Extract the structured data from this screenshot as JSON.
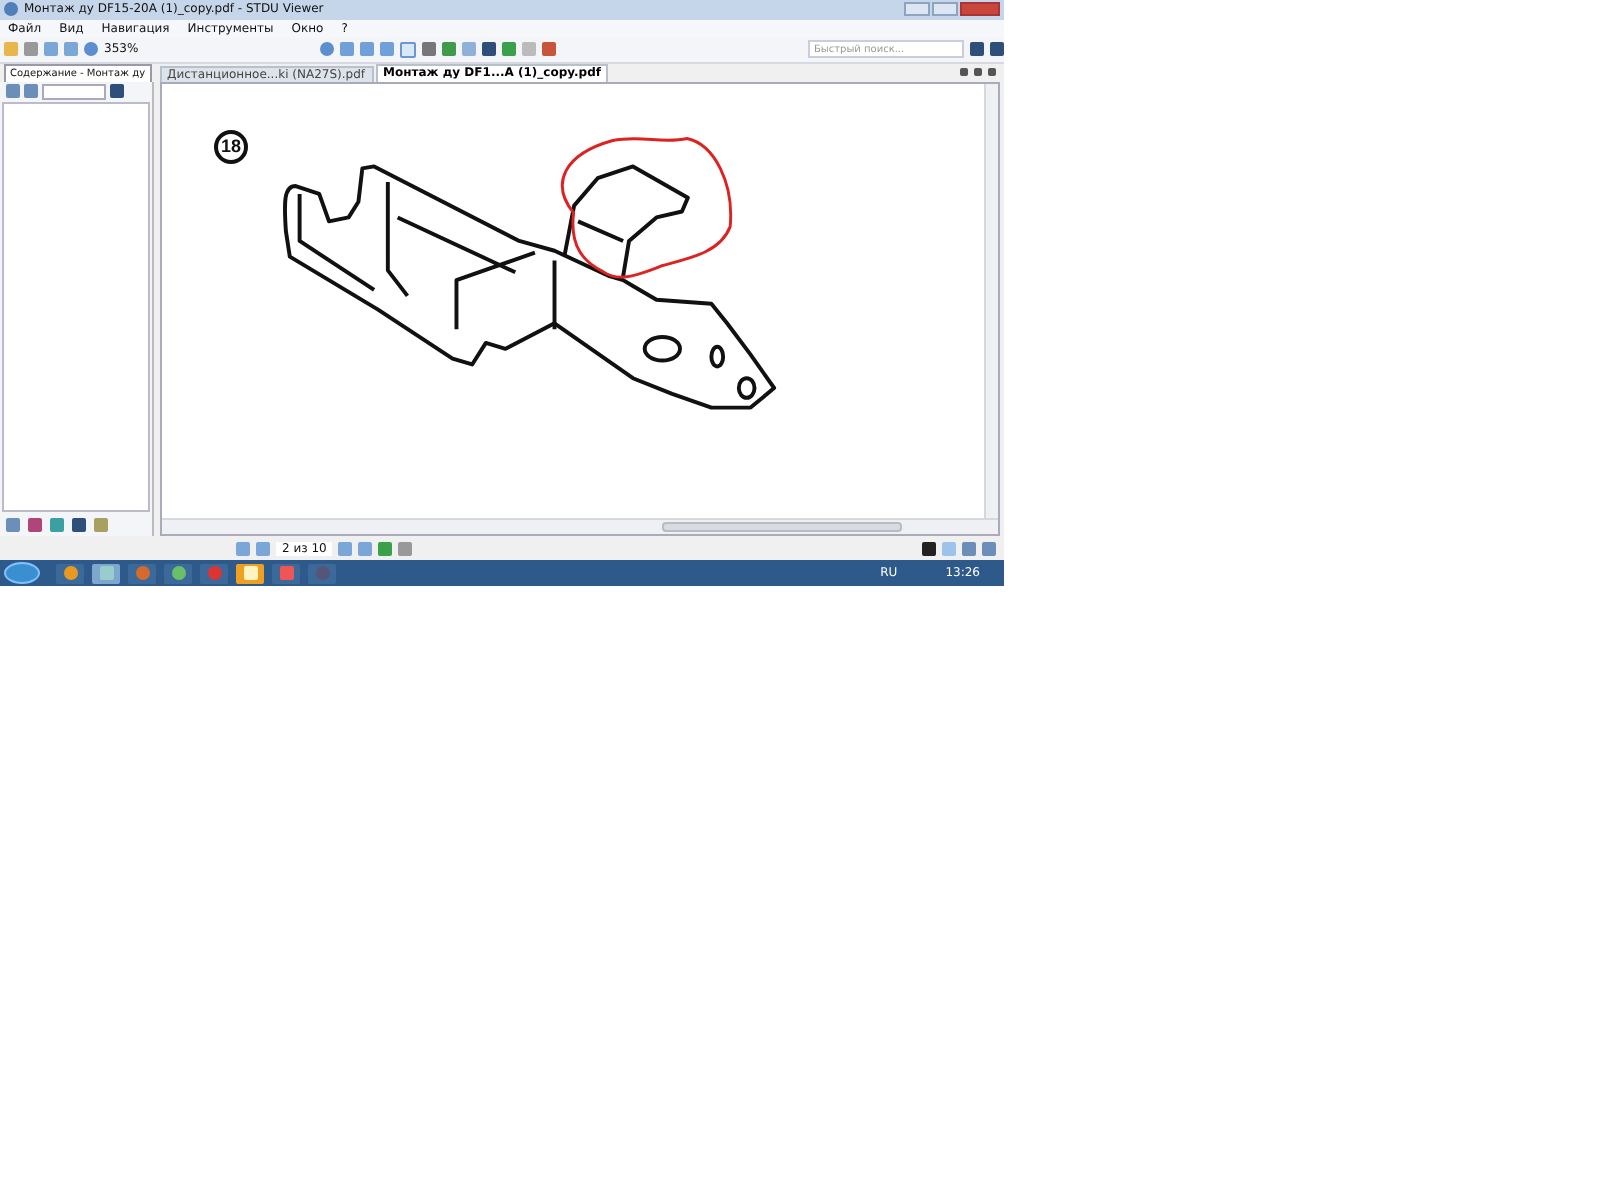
{
  "window": {
    "title": "Монтаж ду DF15-20A (1)_copy.pdf - STDU Viewer"
  },
  "menu": [
    "Файл",
    "Вид",
    "Навигация",
    "Инструменты",
    "Окно",
    "?"
  ],
  "toolbar": {
    "zoom": "353%",
    "search": {
      "placeholder": "Быстрый поиск..."
    }
  },
  "sidebar": {
    "tab": "Содержание - Монтаж ду"
  },
  "tabs": [
    {
      "label": "Дистанционное...ki (NA27S).pdf",
      "selected": false
    },
    {
      "label": "Монтаж ду DF1...A (1)_copy.pdf",
      "selected": true
    }
  ],
  "page": {
    "figure_number": "18"
  },
  "status_bar": {
    "page_indicator": "2 из 10"
  },
  "taskbar": {
    "language": "RU",
    "clock": "13:26"
  }
}
